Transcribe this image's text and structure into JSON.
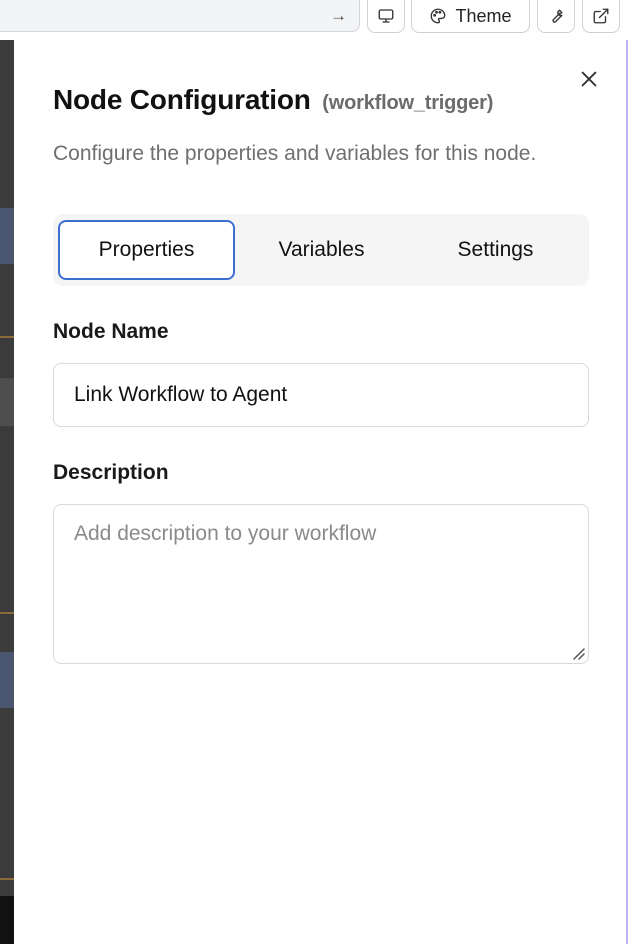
{
  "toolbar": {
    "arrow_icon": "arrow-right-icon",
    "monitor_icon": "monitor-icon",
    "theme_icon": "palette-icon",
    "theme_label": "Theme",
    "wrench_icon": "wrench-icon",
    "external_icon": "external-link-icon"
  },
  "panel": {
    "title": "Node Configuration",
    "subtitle": "(workflow_trigger)",
    "description": "Configure the properties and variables for this node.",
    "close_icon": "close-icon",
    "tabs": [
      {
        "label": "Properties",
        "active": true
      },
      {
        "label": "Variables",
        "active": false
      },
      {
        "label": "Settings",
        "active": false
      }
    ],
    "node_name": {
      "label": "Node Name",
      "value": "Link Workflow to Agent"
    },
    "description_field": {
      "label": "Description",
      "placeholder": "Add description to your workflow",
      "value": ""
    }
  },
  "colors": {
    "accent": "#3c6fd1",
    "panel_edge": "#b9b5f0",
    "backdrop": "#3b3b3b"
  }
}
